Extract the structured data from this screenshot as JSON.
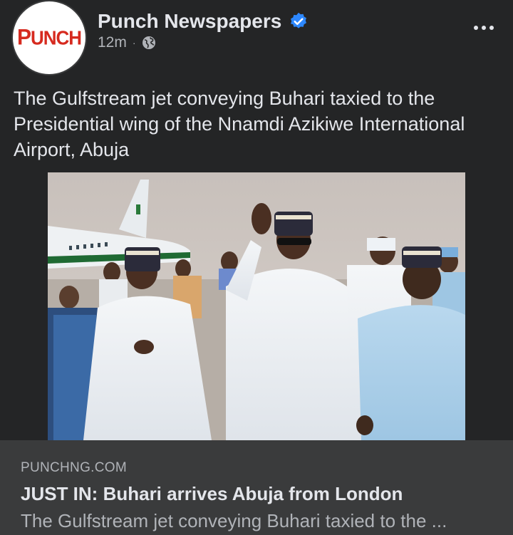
{
  "post": {
    "page_name": "Punch Newspapers",
    "avatar_text": "PUNCH",
    "timestamp": "12m",
    "separator": "·",
    "audience_icon": "globe-icon",
    "verified_icon": "verified-badge-icon",
    "more_icon": "more-options-icon",
    "text": "The Gulfstream jet conveying Buhari taxied to the Presidential wing of the Nnamdi Azikiwe International Airport, Abuja",
    "photo_icon": "photo-of-president-waving-at-airport"
  },
  "link": {
    "domain": "PUNCHNG.COM",
    "title": "JUST IN: Buhari arrives Abuja from London",
    "description": "The Gulfstream jet conveying Buhari taxied to the ..."
  },
  "colors": {
    "background": "#242526",
    "card": "#3a3b3c",
    "text_primary": "#e4e6eb",
    "text_secondary": "#b0b3b8",
    "verified": "#2d88ff",
    "brand_red": "#d62a1f"
  }
}
